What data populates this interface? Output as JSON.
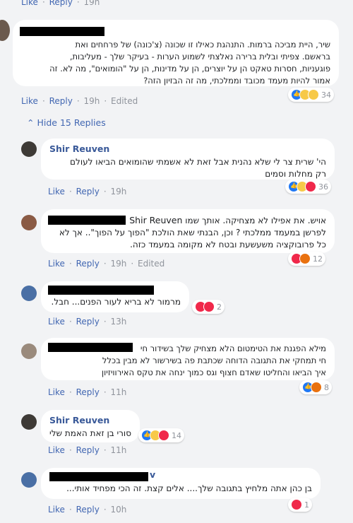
{
  "top_meta": {
    "like": "Like",
    "reply": "Reply",
    "time": "19h"
  },
  "comment1": {
    "text_lines": [
      "שיר, היית מביכה ברמות. התנהגת כאילו זו שכונה (צ'כונה) של פרחחים ואת",
      "בראשם. צפיתי ובלית ברירה נאלצתי לשמוע הערות - בעיקר שלך - מעליבות,",
      "פוגעניות, חסרות טאקט הן על יוצרים, הן על מדינות, הן על \"הומואים\", מה לא. זה",
      "אמור להיות מעמד מכובד וממלכתי, מה זה הבזיון הזה?"
    ],
    "like": "Like",
    "reply": "Reply",
    "time": "19h",
    "edited": "Edited",
    "reactions": "34"
  },
  "hide_replies": "Hide 15 Replies",
  "replies": [
    {
      "author": "Shir Reuven",
      "text_lines": [
        "הי' שרית צר לי שלא נהנית אבל זאת לא אשמתי שהומואים הביאו לעולם",
        "רק מחלות וסמים"
      ],
      "like": "Like",
      "reply": "Reply",
      "time": "19h",
      "reactions": "36"
    },
    {
      "author": "Shir Reuven",
      "text_lines": [
        "אויש. את אפילו לא מצחיקה. אותך שמו",
        "לפרשן במעמד ממלכתי ? וכן, הבנתי שאת הולכת \"הפוך על הפוך\".. אך לא",
        "כל פרובוקציה משעשעת ובטח לא מקומה במעמד כזה."
      ],
      "like": "Like",
      "reply": "Reply",
      "time": "19h",
      "edited": "Edited",
      "reactions": "12"
    },
    {
      "text_lines": [
        "מרמור לא בריא לעור הפנים... חבל."
      ],
      "like": "Like",
      "reply": "Reply",
      "time": "13h",
      "reactions": "2"
    },
    {
      "author": "Shir Reuven",
      "text_lines": [
        "מילא הפגנת את הטימטום הלא מצחיק שלך בשידור חי",
        "חי תמחקי את התגובה הדוחה שכתבת פה בשירשור לא מבין בכלל",
        "איך הביאו והחליטו שאדם חצוף וגס כמוך ינחה את טקס האירוויזיון"
      ],
      "like": "Like",
      "reply": "Reply",
      "time": "11h",
      "reactions": "8"
    },
    {
      "author": "Shir Reuven",
      "text_lines": [
        "סורי בן זאת האמת שלי"
      ],
      "like": "Like",
      "reply": "Reply",
      "time": "11h",
      "reactions": "14"
    },
    {
      "author_suffix": "v",
      "text_lines": [
        "בן כהן אתה מלחיץ בתגובה שלך.... אלים קצת. זה הכי מפחיד אותי..."
      ],
      "like": "Like",
      "reply": "Reply",
      "time": "10h",
      "reactions": "1"
    }
  ]
}
